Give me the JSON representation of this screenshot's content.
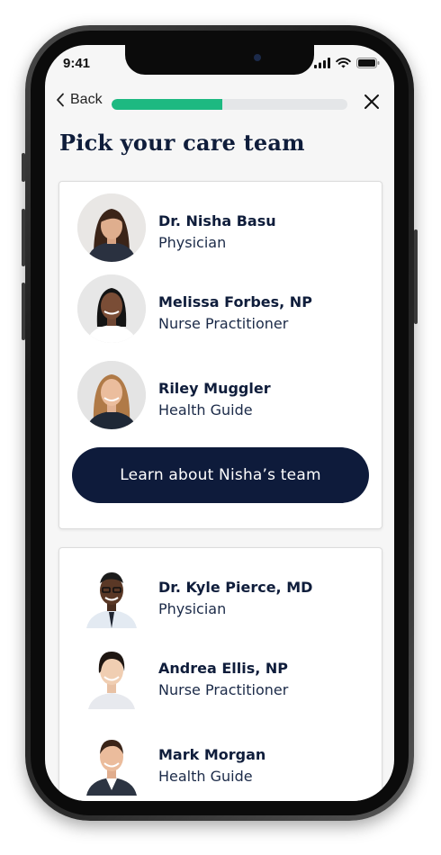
{
  "status_bar": {
    "time": "9:41"
  },
  "header": {
    "back_label": "Back",
    "progress": 0.47
  },
  "page": {
    "title": "Pick your care team"
  },
  "teams": [
    {
      "members": [
        {
          "name": "Dr. Nisha Basu",
          "role": "Physician",
          "avatar": "woman-avatar"
        },
        {
          "name": "Melissa Forbes, NP",
          "role": "Nurse Practitioner",
          "avatar": "woman-avatar"
        },
        {
          "name": "Riley Muggler",
          "role": "Health Guide",
          "avatar": "woman-avatar"
        }
      ],
      "cta_label": "Learn about Nisha’s team"
    },
    {
      "members": [
        {
          "name": "Dr. Kyle Pierce, MD",
          "role": "Physician",
          "avatar": "man-avatar"
        },
        {
          "name": "Andrea Ellis, NP",
          "role": "Nurse Practitioner",
          "avatar": "woman-avatar"
        },
        {
          "name": "Mark Morgan",
          "role": "Health Guide",
          "avatar": "man-avatar"
        }
      ]
    }
  ],
  "colors": {
    "brand_navy": "#0e1b3b",
    "progress_green": "#1db981",
    "progress_track": "#e4e6e8"
  }
}
